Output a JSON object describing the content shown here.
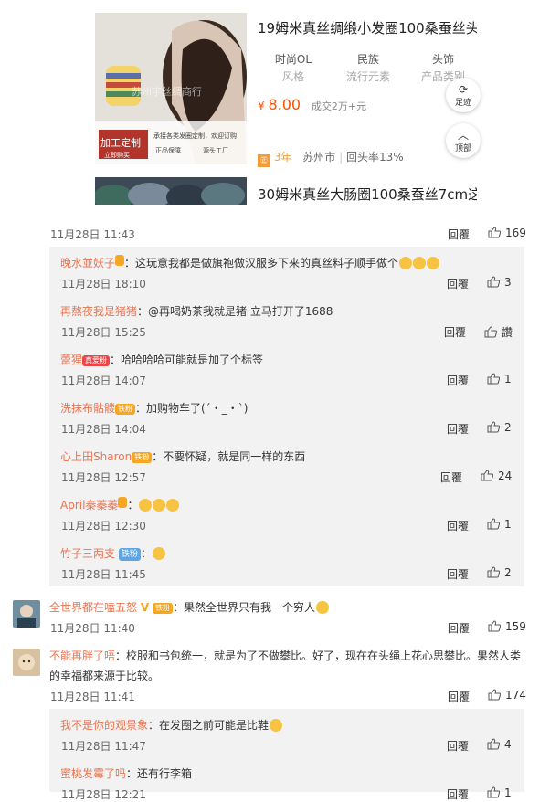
{
  "products": [
    {
      "title": "19姆米真丝绸缎小发圈100桑蚕丝头",
      "attrs": [
        {
          "k": "时尚OL",
          "v": "风格"
        },
        {
          "k": "民族",
          "v": "流行元素"
        },
        {
          "k": "头饰",
          "v": "产品类别"
        }
      ],
      "price": "8.00",
      "currency": "¥",
      "sold": "成交2万+元",
      "store_badge": "3年",
      "city": "苏州市",
      "repurchase": "回头率13%",
      "img_text_1": "加工定制",
      "img_text_2": "立即购买",
      "img_text_3": "承接各类发圈定制，欢迎订购",
      "img_text_4": "正品保障",
      "img_text_5": "源头工厂",
      "watermark": "苏州宇丝绸商行"
    },
    {
      "title": "30姆米真丝大肠圈100桑蚕丝7cm这"
    }
  ],
  "float_buttons": {
    "footprint": "足迹",
    "top": "顶部"
  },
  "labels": {
    "reply": "回覆"
  },
  "comments": [
    {
      "time": "11月28日 11:43",
      "likes": "169"
    },
    {
      "user": "晚水並妖子",
      "text": "：这玩意我都是做旗袍做汉服多下来的真丝料子顺手做个",
      "time": "11月28日 18:10",
      "likes": "3"
    },
    {
      "user": "再熬夜我是猪猪",
      "text": "：@再喝奶茶我就是猪 立马打开了1688",
      "mention": "@再喝奶茶我就是猪",
      "time": "11月28日 15:25",
      "likes": "讚"
    },
    {
      "user": "蕾猩",
      "badge": "真爱粉",
      "text": "：哈哈哈哈可能就是加了个标签",
      "time": "11月28日 14:07",
      "likes": "1"
    },
    {
      "user": "洗抹布骷髅",
      "badge": "铁粉",
      "text": "：加购物车了(´・_・`)",
      "time": "11月28日 14:04",
      "likes": "2"
    },
    {
      "user": "心上田Sharon",
      "badge": "铁粉",
      "text": "：不要怀疑，就是同一样的东西",
      "time": "11月28日 12:57",
      "likes": "24"
    },
    {
      "user": "April秦蓁蓁",
      "text": "：",
      "time": "11月28日 12:30",
      "likes": "1"
    },
    {
      "user": "竹子三两支",
      "badge": "铁粉",
      "text": "：",
      "time": "11月28日 11:45",
      "likes": "2"
    },
    {
      "user": "全世界都在嗑五怒",
      "badge": "铁粉",
      "text": "：果然全世界只有我一个穷人",
      "time": "11月28日 11:40",
      "likes": "159"
    },
    {
      "user": "不能再胖了唔",
      "text": "：校服和书包统一，就是为了不做攀比。好了，现在在头绳上花心思攀比。果然人类",
      "text2": "的幸福都来源于比较。",
      "time": "11月28日 11:41",
      "likes": "174"
    },
    {
      "user": "我不是你的观景象",
      "text": "：在发圈之前可能是比鞋",
      "time": "11月28日 11:47",
      "likes": "4"
    },
    {
      "user": "蜜桃发霉了吗",
      "text": "：还有行李箱",
      "time": "11月28日 12:21",
      "likes": "1"
    }
  ],
  "colors": {
    "accent": "#eb7350",
    "price": "#ff5000",
    "subbg": "#f2f2f2",
    "badge_iron": "#f5a623",
    "badge_true": "#e8484a",
    "badge_blue": "#5fa5e3"
  }
}
